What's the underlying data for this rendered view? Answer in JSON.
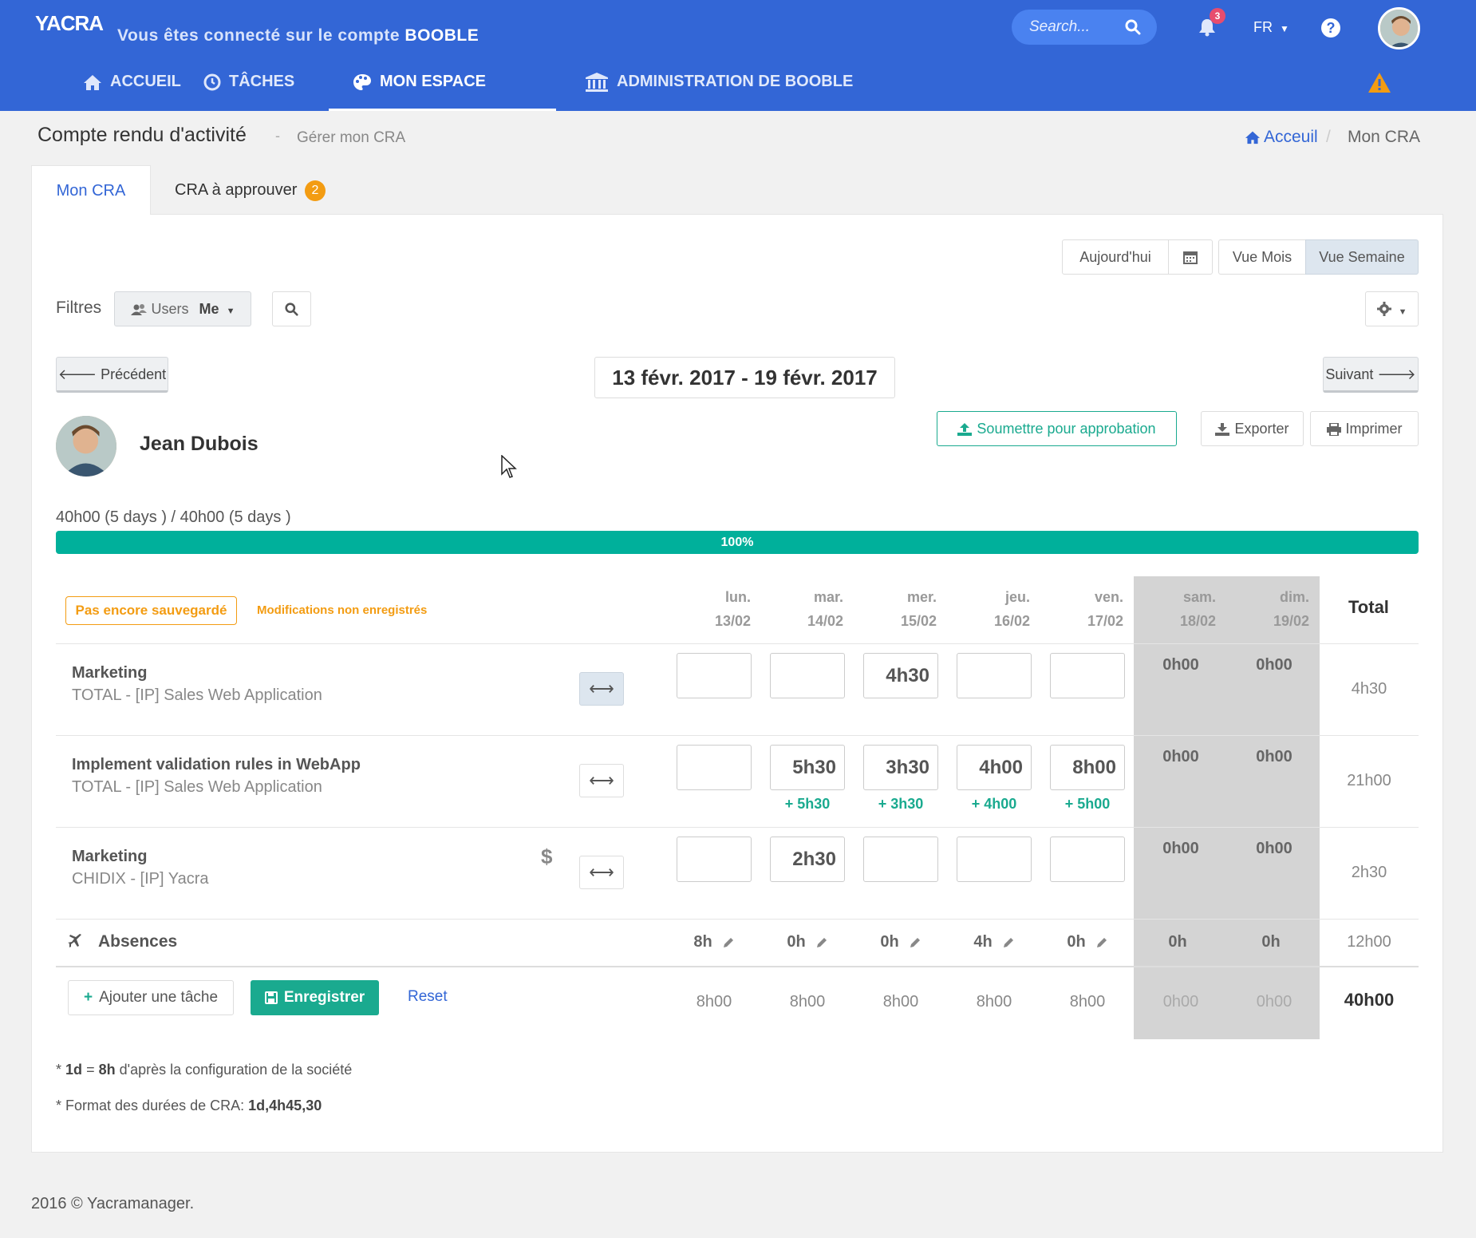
{
  "header": {
    "logo": "YACRA",
    "account_prefix": "Vous êtes connecté sur le compte",
    "account_name": "BOOBLE",
    "search_placeholder": "Search...",
    "notifications_count": "3",
    "language": "FR",
    "help": "?",
    "nav": [
      {
        "label": "ACCUEIL",
        "icon": "home-icon"
      },
      {
        "label": "TÂCHES",
        "icon": "clock-icon"
      },
      {
        "label": "MON ESPACE",
        "icon": "palette-icon",
        "active": true
      },
      {
        "label": "ADMINISTRATION DE BOOBLE",
        "icon": "bank-icon"
      }
    ]
  },
  "page": {
    "title": "Compte rendu d'activité",
    "separator": "-",
    "subtitle": "Gérer mon CRA",
    "breadcrumb_home": "Acceuil",
    "breadcrumb_sep": "/",
    "breadcrumb_current": "Mon CRA"
  },
  "tabs": [
    {
      "label": "Mon CRA",
      "active": true
    },
    {
      "label": "CRA à approuver",
      "badge": "2"
    }
  ],
  "toolbar": {
    "today": "Aujourd'hui",
    "month_view": "Vue Mois",
    "week_view": "Vue Semaine",
    "filters_label": "Filtres",
    "users_label": "Users",
    "users_value": "Me",
    "prev": "Précédent",
    "next": "Suivant",
    "date_range": "13 févr. 2017 - 19 févr. 2017",
    "submit": "Soumettre pour approbation",
    "export": "Exporter",
    "print": "Imprimer"
  },
  "user": {
    "name": "Jean Dubois",
    "hours_summary": "40h00 (5 days ) / 40h00 (5 days )",
    "progress_label": "100%",
    "progress": 1.0
  },
  "grid": {
    "status_badge": "Pas encore sauvegardé",
    "status_msg": "Modifications non enregistrés",
    "total_label": "Total",
    "days": [
      {
        "day": "lun.",
        "date": "13/02"
      },
      {
        "day": "mar.",
        "date": "14/02"
      },
      {
        "day": "mer.",
        "date": "15/02"
      },
      {
        "day": "jeu.",
        "date": "16/02"
      },
      {
        "day": "ven.",
        "date": "17/02"
      },
      {
        "day": "sam.",
        "date": "18/02"
      },
      {
        "day": "dim.",
        "date": "19/02"
      }
    ],
    "rows": [
      {
        "title": "Marketing",
        "subtitle": "TOTAL - [IP] Sales Web Application",
        "values": [
          "",
          "",
          "4h30",
          "",
          ""
        ],
        "deltas": [
          "",
          "",
          "",
          "",
          ""
        ],
        "weekend": [
          "0h00",
          "0h00"
        ],
        "total": "4h30",
        "billable": ""
      },
      {
        "title": "Implement validation rules in WebApp",
        "subtitle": "TOTAL - [IP] Sales Web Application",
        "values": [
          "",
          "5h30",
          "3h30",
          "4h00",
          "8h00"
        ],
        "deltas": [
          "",
          "+ 5h30",
          "+ 3h30",
          "+ 4h00",
          "+ 5h00"
        ],
        "weekend": [
          "0h00",
          "0h00"
        ],
        "total": "21h00",
        "billable": ""
      },
      {
        "title": "Marketing",
        "subtitle": "CHIDIX - [IP] Yacra",
        "values": [
          "",
          "2h30",
          "",
          "",
          ""
        ],
        "deltas": [
          "",
          "",
          "",
          "",
          ""
        ],
        "weekend": [
          "0h00",
          "0h00"
        ],
        "total": "2h30",
        "billable": "$"
      }
    ],
    "absences": {
      "label": "Absences",
      "values": [
        "8h",
        "0h",
        "0h",
        "4h",
        "0h",
        "0h",
        "0h"
      ],
      "total": "12h00"
    },
    "footer": {
      "add_task": "Ajouter une tâche",
      "save": "Enregistrer",
      "reset": "Reset",
      "totals": [
        "8h00",
        "8h00",
        "8h00",
        "8h00",
        "8h00",
        "0h00",
        "0h00"
      ],
      "grand_total": "40h00"
    }
  },
  "notes": {
    "n1_star": "*",
    "n1_a": "1d",
    "n1_b": "=",
    "n1_c": "8h",
    "n1_d": "d'après la configuration de la société",
    "n2_star": "*",
    "n2_a": "Format des durées de CRA:",
    "n2_b": "1d,4h45,30"
  },
  "footer": {
    "copyright": "2016 © Yacramanager."
  },
  "colors": {
    "header": "#3366d6",
    "accent_green": "#1aaa8f",
    "progress": "#00b09b",
    "warning": "#f39c12",
    "weekend": "#d4d4d4"
  }
}
